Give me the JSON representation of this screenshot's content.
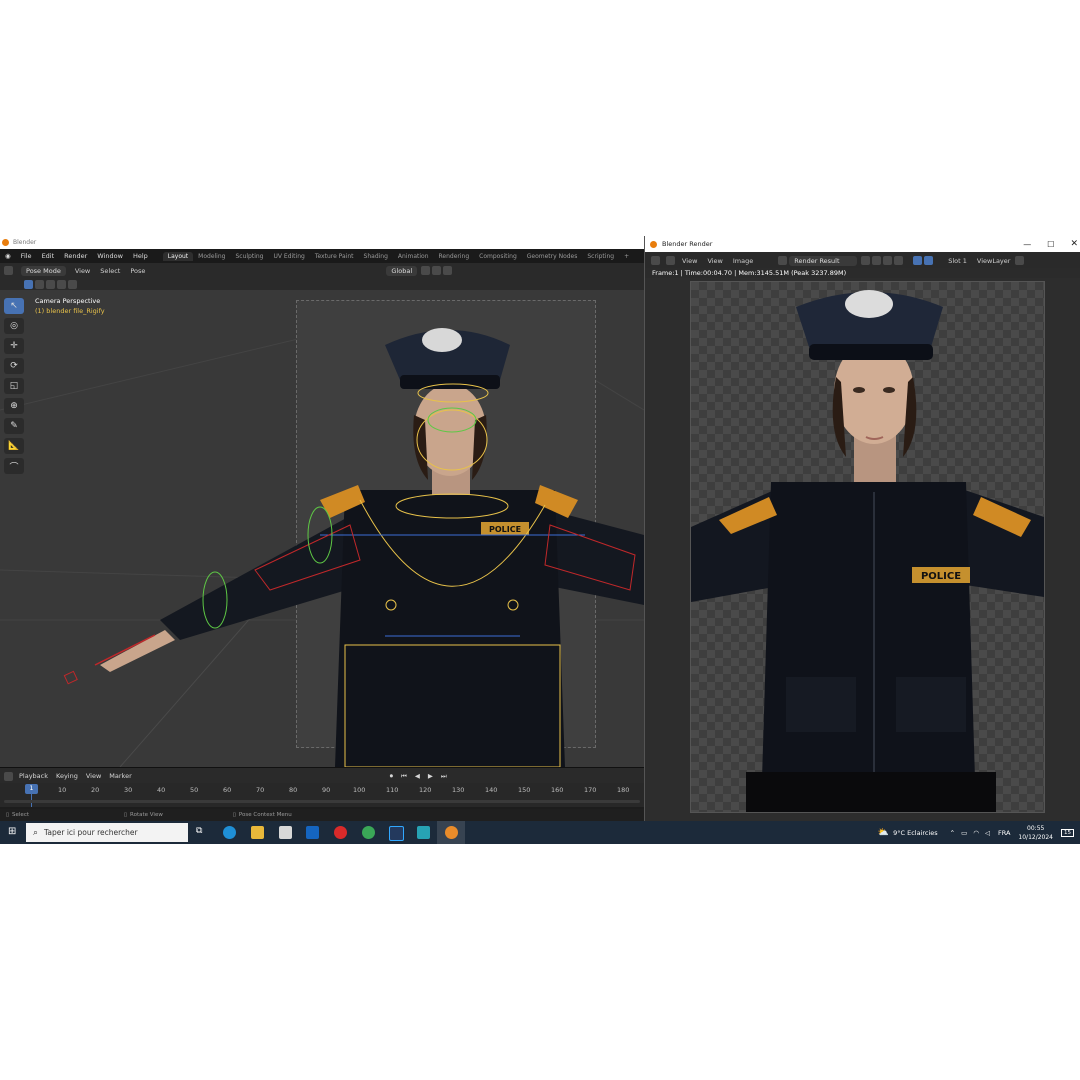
{
  "blender": {
    "title": "Blender",
    "menu": [
      "File",
      "Edit",
      "Render",
      "Window",
      "Help"
    ],
    "workspaces": [
      "Layout",
      "Modeling",
      "Sculpting",
      "UV Editing",
      "Texture Paint",
      "Shading",
      "Animation",
      "Rendering",
      "Compositing",
      "Geometry Nodes",
      "Scripting",
      "+"
    ],
    "active_workspace": "Layout",
    "header": {
      "mode": "Pose Mode",
      "menus": [
        "View",
        "Select",
        "Pose"
      ],
      "orientation": "Global"
    },
    "viewport": {
      "camera_label": "Camera Perspective",
      "object_label": "(1) blender file_Rigify"
    },
    "timeline": {
      "menus": [
        "Playback",
        "Keying",
        "View",
        "Marker"
      ],
      "current_frame": "1",
      "ticks": [
        "10",
        "20",
        "30",
        "40",
        "50",
        "60",
        "70",
        "80",
        "90",
        "100",
        "110",
        "120",
        "130",
        "140",
        "150",
        "160",
        "170",
        "180"
      ]
    },
    "status": {
      "select": "Select",
      "rotate": "Rotate View",
      "context": "Pose Context Menu"
    }
  },
  "render_window": {
    "title": "Blender Render",
    "menus": [
      "View",
      "View",
      "Image"
    ],
    "render_result": "Render Result",
    "slot": "Slot 1",
    "view_layer": "ViewLayer",
    "info": "Frame:1 | Time:00:04.70 | Mem:3145.51M (Peak 3237.89M)",
    "badge_text": "POLICE"
  },
  "viewport_badge_text": "POLICE",
  "taskbar": {
    "search_placeholder": "Taper ici pour rechercher",
    "weather": "9°C  Eclaircies",
    "language": "FRA",
    "time": "00:55",
    "date": "10/12/2024",
    "notifications": "15"
  },
  "colors": {
    "blender_accent": "#4772b3",
    "blender_orange": "#e87d0d",
    "bone_yellow": "#e8c24a",
    "taskbar": "#1c2a3a"
  }
}
